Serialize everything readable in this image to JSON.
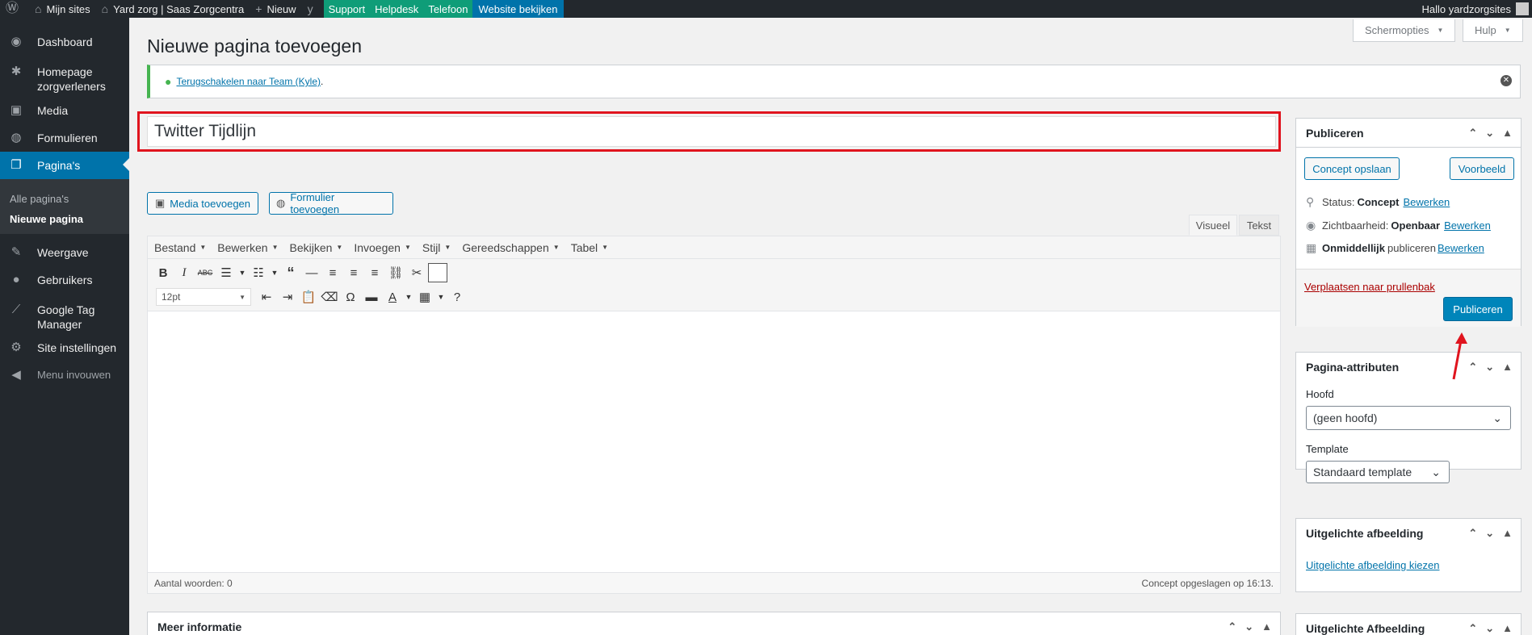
{
  "admin_bar": {
    "my_sites": "Mijn sites",
    "site_name": "Yard zorg | Saas Zorgcentra",
    "new": "Nieuw",
    "support": "Support",
    "helpdesk": "Helpdesk",
    "phone": "Telefoon",
    "view_site": "Website bekijken",
    "greeting": "Hallo yardzorgsites"
  },
  "sidebar": {
    "items": [
      {
        "label": "Dashboard",
        "icon": "dashboard-icon"
      },
      {
        "label": "Homepage zorgverleners",
        "icon": "pin-icon"
      },
      {
        "label": "Media",
        "icon": "media-icon"
      },
      {
        "label": "Formulieren",
        "icon": "forms-icon"
      },
      {
        "label": "Pagina's",
        "icon": "pages-icon"
      },
      {
        "label": "Weergave",
        "icon": "appearance-icon"
      },
      {
        "label": "Gebruikers",
        "icon": "users-icon"
      },
      {
        "label": "Google Tag Manager",
        "icon": "chart-icon"
      },
      {
        "label": "Site instellingen",
        "icon": "settings-icon"
      },
      {
        "label": "Menu invouwen",
        "icon": "collapse-icon"
      }
    ],
    "sub_all": "Alle pagina's",
    "sub_new": "Nieuwe pagina"
  },
  "header": {
    "title": "Nieuwe pagina toevoegen",
    "screen_options": "Schermopties",
    "help": "Hulp"
  },
  "notice": {
    "link": "Terugschakelen naar Team (Kyle)",
    "suffix": "."
  },
  "editor": {
    "title_value": "Twitter Tijdlijn",
    "add_media": "Media toevoegen",
    "add_form": "Formulier toevoegen",
    "tab_visual": "Visueel",
    "tab_text": "Tekst",
    "menus": [
      "Bestand",
      "Bewerken",
      "Bekijken",
      "Invoegen",
      "Stijl",
      "Gereedschappen",
      "Tabel"
    ],
    "font_size": "12pt",
    "word_count": "Aantal woorden: 0",
    "draft_saved": "Concept opgeslagen op 16:13."
  },
  "publish_box": {
    "title": "Publiceren",
    "save_draft": "Concept opslaan",
    "preview": "Voorbeeld",
    "status_label": "Status:",
    "status_value": "Concept",
    "visibility_label": "Zichtbaarheid:",
    "visibility_value": "Openbaar",
    "schedule_value": "Onmiddellijk",
    "schedule_suffix": "publiceren",
    "edit": "Bewerken",
    "trash": "Verplaatsen naar prullenbak",
    "publish": "Publiceren"
  },
  "attributes_box": {
    "title": "Pagina-attributen",
    "parent_label": "Hoofd",
    "parent_value": "(geen hoofd)",
    "template_label": "Template",
    "template_value": "Standaard template"
  },
  "featured_box": {
    "title": "Uitgelichte afbeelding",
    "link": "Uitgelichte afbeelding kiezen"
  },
  "featured_box2": {
    "title": "Uitgelichte Afbeelding"
  },
  "more_info": {
    "title": "Meer informatie"
  },
  "colors": {
    "accent": "#0073aa",
    "highlight": "#e0141e",
    "success": "#46b450"
  }
}
